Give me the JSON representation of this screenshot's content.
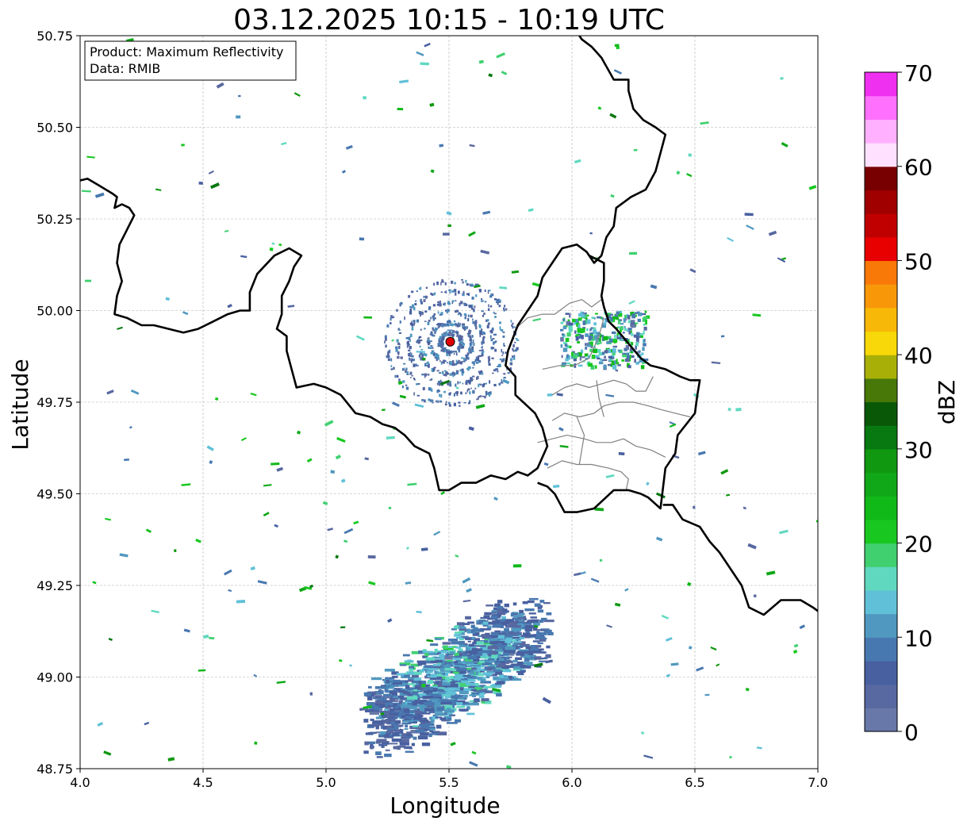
{
  "title": "03.12.2025 10:15 - 10:19 UTC",
  "info_box": {
    "product": "Product: Maximum Reflectivity",
    "source": "Data: RMIB"
  },
  "axes": {
    "xlabel": "Longitude",
    "ylabel": "Latitude",
    "xlim": [
      4.0,
      7.0
    ],
    "ylim": [
      48.75,
      50.75
    ],
    "x_ticks": [
      "4.0",
      "4.5",
      "5.0",
      "5.5",
      "6.0",
      "6.5",
      "7.0"
    ],
    "x_tick_values": [
      4.0,
      4.5,
      5.0,
      5.5,
      6.0,
      6.5,
      7.0
    ],
    "y_ticks": [
      "48.75",
      "49.00",
      "49.25",
      "49.50",
      "49.75",
      "50.00",
      "50.25",
      "50.50",
      "50.75"
    ],
    "y_tick_values": [
      48.75,
      49.0,
      49.25,
      49.5,
      49.75,
      50.0,
      50.25,
      50.5,
      50.75
    ],
    "grid": true
  },
  "radar_site": {
    "lon": 5.505,
    "lat": 49.915,
    "color": "#e00000"
  },
  "colorbar": {
    "label": "dBZ",
    "min": 0,
    "max": 70,
    "ticks": [
      "0",
      "10",
      "20",
      "30",
      "40",
      "50",
      "60",
      "70"
    ],
    "tick_values": [
      0,
      10,
      20,
      30,
      40,
      50,
      60,
      70
    ],
    "colors": [
      "#6878a8",
      "#5868a0",
      "#4860a0",
      "#4878b0",
      "#5098c0",
      "#60c0d8",
      "#60d8c0",
      "#40d070",
      "#18c820",
      "#10b818",
      "#10a818",
      "#109810",
      "#087810",
      "#085808",
      "#487808",
      "#a8b008",
      "#f8d808",
      "#f8b808",
      "#f89808",
      "#f87808",
      "#e80000",
      "#c00000",
      "#a00000",
      "#780000",
      "#ffe0ff",
      "#ffb0ff",
      "#ff70ff",
      "#f030f0"
    ]
  },
  "chart_data": {
    "type": "heatmap",
    "title": "03.12.2025 10:15 - 10:19 UTC",
    "xlabel": "Longitude",
    "ylabel": "Latitude",
    "xlim": [
      4.0,
      7.0
    ],
    "ylim": [
      48.75,
      50.75
    ],
    "value_label": "dBZ",
    "value_range": [
      0,
      70
    ],
    "echo_regions": [
      {
        "name": "southern precipitation area",
        "lon_range": [
          5.15,
          5.9
        ],
        "lat_range": [
          48.75,
          49.25
        ],
        "dbz_range": [
          2,
          22
        ]
      },
      {
        "name": "clutter near radar",
        "lon_range": [
          5.3,
          5.7
        ],
        "lat_range": [
          49.8,
          50.05
        ],
        "dbz_range": [
          2,
          12
        ]
      },
      {
        "name": "eastern scattered echoes",
        "lon_range": [
          5.95,
          6.3
        ],
        "lat_range": [
          49.85,
          50.0
        ],
        "dbz_range": [
          2,
          25
        ]
      }
    ]
  },
  "borders": {
    "national": [
      [
        [
          4.0,
          50.355
        ],
        [
          4.03,
          50.36
        ],
        [
          4.08,
          50.34
        ],
        [
          4.13,
          50.32
        ],
        [
          4.15,
          50.31
        ],
        [
          4.14,
          50.28
        ],
        [
          4.17,
          50.29
        ],
        [
          4.2,
          50.28
        ],
        [
          4.22,
          50.26
        ],
        [
          4.19,
          50.22
        ],
        [
          4.16,
          50.18
        ],
        [
          4.15,
          50.13
        ],
        [
          4.17,
          50.08
        ],
        [
          4.15,
          50.04
        ],
        [
          4.14,
          49.99
        ],
        [
          4.19,
          49.98
        ],
        [
          4.25,
          49.96
        ],
        [
          4.3,
          49.96
        ],
        [
          4.36,
          49.95
        ],
        [
          4.42,
          49.94
        ],
        [
          4.48,
          49.95
        ],
        [
          4.54,
          49.97
        ],
        [
          4.6,
          49.99
        ],
        [
          4.65,
          50.0
        ],
        [
          4.69,
          50.0
        ],
        [
          4.69,
          50.05
        ],
        [
          4.72,
          50.1
        ],
        [
          4.79,
          50.15
        ],
        [
          4.85,
          50.17
        ],
        [
          4.9,
          50.15
        ],
        [
          4.87,
          50.12
        ],
        [
          4.85,
          50.08
        ],
        [
          4.82,
          50.04
        ],
        [
          4.82,
          49.99
        ],
        [
          4.8,
          49.95
        ],
        [
          4.84,
          49.93
        ],
        [
          4.84,
          49.89
        ],
        [
          4.86,
          49.84
        ],
        [
          4.88,
          49.79
        ],
        [
          4.95,
          49.8
        ],
        [
          5.0,
          49.79
        ],
        [
          5.06,
          49.77
        ],
        [
          5.12,
          49.72
        ],
        [
          5.18,
          49.71
        ],
        [
          5.23,
          49.69
        ],
        [
          5.28,
          49.68
        ],
        [
          5.32,
          49.66
        ],
        [
          5.36,
          49.63
        ],
        [
          5.42,
          49.61
        ],
        [
          5.44,
          49.57
        ],
        [
          5.46,
          49.51
        ],
        [
          5.5,
          49.51
        ],
        [
          5.55,
          49.53
        ],
        [
          5.61,
          49.53
        ],
        [
          5.67,
          49.55
        ],
        [
          5.73,
          49.54
        ],
        [
          5.78,
          49.56
        ],
        [
          5.82,
          49.55
        ],
        [
          5.86,
          49.57
        ],
        [
          5.9,
          49.63
        ],
        [
          5.88,
          49.68
        ],
        [
          5.85,
          49.72
        ],
        [
          5.77,
          49.77
        ],
        [
          5.77,
          49.82
        ],
        [
          5.73,
          49.85
        ],
        [
          5.74,
          49.89
        ],
        [
          5.78,
          49.96
        ],
        [
          5.82,
          50.0
        ],
        [
          5.86,
          50.04
        ],
        [
          5.88,
          50.09
        ],
        [
          5.92,
          50.13
        ],
        [
          5.96,
          50.17
        ],
        [
          6.02,
          50.18
        ],
        [
          6.06,
          50.16
        ],
        [
          6.09,
          50.13
        ],
        [
          6.12,
          50.15
        ],
        [
          6.14,
          50.2
        ],
        [
          6.17,
          50.23
        ],
        [
          6.18,
          50.28
        ],
        [
          6.24,
          50.31
        ],
        [
          6.3,
          50.33
        ],
        [
          6.34,
          50.38
        ],
        [
          6.36,
          50.43
        ],
        [
          6.38,
          50.48
        ],
        [
          6.34,
          50.5
        ],
        [
          6.29,
          50.52
        ],
        [
          6.25,
          50.55
        ],
        [
          6.23,
          50.6
        ],
        [
          6.23,
          50.63
        ],
        [
          6.17,
          50.63
        ],
        [
          6.12,
          50.69
        ],
        [
          6.08,
          50.72
        ],
        [
          6.04,
          50.74
        ],
        [
          6.03,
          50.75
        ]
      ],
      [
        [
          6.07,
          50.15
        ],
        [
          6.13,
          50.13
        ],
        [
          6.13,
          50.08
        ],
        [
          6.12,
          50.04
        ],
        [
          6.13,
          50.01
        ],
        [
          6.15,
          49.97
        ],
        [
          6.18,
          49.95
        ],
        [
          6.23,
          49.91
        ],
        [
          6.28,
          49.87
        ],
        [
          6.32,
          49.85
        ],
        [
          6.38,
          49.84
        ],
        [
          6.44,
          49.82
        ],
        [
          6.48,
          49.81
        ],
        [
          6.52,
          49.81
        ],
        [
          6.51,
          49.77
        ],
        [
          6.5,
          49.72
        ],
        [
          6.43,
          49.66
        ],
        [
          6.42,
          49.61
        ],
        [
          6.38,
          49.57
        ],
        [
          6.36,
          49.46
        ],
        [
          6.31,
          49.49
        ],
        [
          6.28,
          49.5
        ],
        [
          6.23,
          49.51
        ],
        [
          6.17,
          49.51
        ],
        [
          6.09,
          49.46
        ],
        [
          6.02,
          49.45
        ],
        [
          5.97,
          49.45
        ],
        [
          5.93,
          49.5
        ],
        [
          5.9,
          49.52
        ],
        [
          5.86,
          49.53
        ]
      ],
      [
        [
          6.37,
          49.47
        ],
        [
          6.41,
          49.47
        ],
        [
          6.45,
          49.43
        ],
        [
          6.52,
          49.41
        ],
        [
          6.56,
          49.37
        ],
        [
          6.6,
          49.34
        ],
        [
          6.65,
          49.29
        ],
        [
          6.69,
          49.25
        ],
        [
          6.72,
          49.19
        ],
        [
          6.78,
          49.17
        ],
        [
          6.85,
          49.21
        ],
        [
          6.88,
          49.21
        ],
        [
          6.93,
          49.21
        ],
        [
          6.98,
          49.19
        ],
        [
          7.0,
          49.18
        ]
      ]
    ],
    "regional": [
      [
        [
          5.77,
          49.95
        ],
        [
          5.82,
          49.98
        ],
        [
          5.88,
          49.99
        ],
        [
          5.93,
          49.99
        ],
        [
          5.99,
          50.02
        ],
        [
          6.04,
          50.03
        ],
        [
          6.08,
          50.01
        ],
        [
          6.12,
          50.03
        ]
      ],
      [
        [
          5.88,
          49.84
        ],
        [
          5.95,
          49.85
        ],
        [
          6.01,
          49.85
        ],
        [
          6.07,
          49.87
        ],
        [
          6.11,
          49.93
        ],
        [
          6.13,
          49.98
        ]
      ],
      [
        [
          5.92,
          49.77
        ],
        [
          5.97,
          49.79
        ],
        [
          6.02,
          49.8
        ],
        [
          6.07,
          49.79
        ],
        [
          6.12,
          49.8
        ],
        [
          6.17,
          49.81
        ],
        [
          6.22,
          49.8
        ],
        [
          6.26,
          49.78
        ],
        [
          6.3,
          49.78
        ],
        [
          6.33,
          49.82
        ]
      ],
      [
        [
          5.92,
          49.7
        ],
        [
          5.97,
          49.72
        ],
        [
          6.03,
          49.71
        ],
        [
          6.09,
          49.72
        ],
        [
          6.13,
          49.74
        ],
        [
          6.19,
          49.75
        ],
        [
          6.25,
          49.75
        ],
        [
          6.31,
          49.74
        ],
        [
          6.36,
          49.73
        ],
        [
          6.42,
          49.72
        ],
        [
          6.48,
          49.71
        ]
      ],
      [
        [
          5.86,
          49.64
        ],
        [
          5.92,
          49.65
        ],
        [
          5.98,
          49.66
        ],
        [
          6.05,
          49.65
        ],
        [
          6.1,
          49.64
        ],
        [
          6.16,
          49.64
        ],
        [
          6.21,
          49.65
        ],
        [
          6.26,
          49.63
        ],
        [
          6.32,
          49.62
        ],
        [
          6.38,
          49.6
        ]
      ],
      [
        [
          5.9,
          49.57
        ],
        [
          5.96,
          49.59
        ],
        [
          6.02,
          49.58
        ],
        [
          6.08,
          49.58
        ],
        [
          6.15,
          49.57
        ],
        [
          6.2,
          49.56
        ],
        [
          6.23,
          49.54
        ],
        [
          6.22,
          49.51
        ]
      ],
      [
        [
          6.1,
          49.81
        ],
        [
          6.11,
          49.76
        ],
        [
          6.13,
          49.71
        ]
      ],
      [
        [
          6.02,
          49.71
        ],
        [
          6.05,
          49.66
        ],
        [
          6.03,
          49.58
        ]
      ]
    ]
  }
}
